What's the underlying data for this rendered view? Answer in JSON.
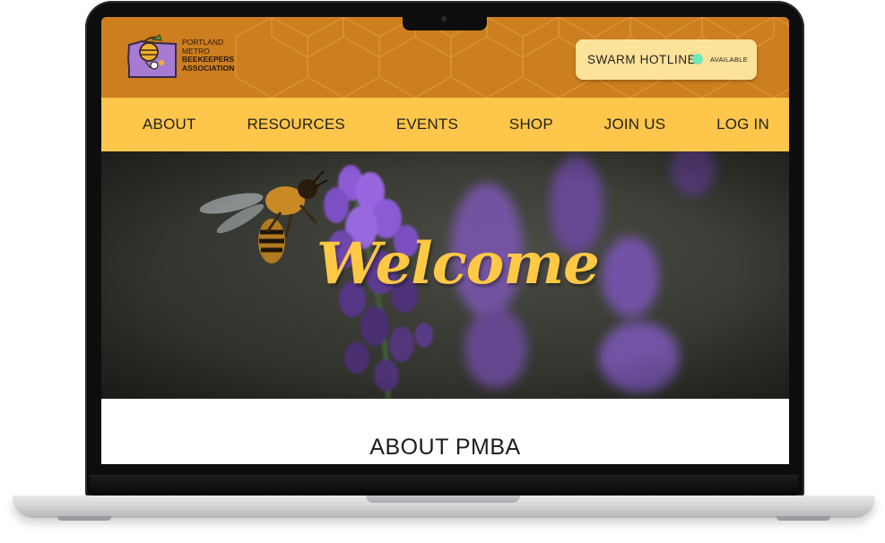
{
  "header": {
    "logo": {
      "line1": "PORTLAND",
      "line2": "METRO",
      "line3": "BEEKEEPERS",
      "line4": "ASSOCIATION"
    },
    "hotline": {
      "label": "SWARM HOTLINE",
      "status": "AVAILABLE",
      "status_color": "#71e8b9"
    }
  },
  "nav": {
    "items": [
      {
        "label": "ABOUT"
      },
      {
        "label": "RESOURCES"
      },
      {
        "label": "EVENTS"
      },
      {
        "label": "SHOP"
      },
      {
        "label": "JOIN US"
      },
      {
        "label": "LOG IN"
      }
    ]
  },
  "hero": {
    "heading": "Welcome"
  },
  "about": {
    "title": "ABOUT PMBA"
  },
  "colors": {
    "header_bg": "#cd7e1f",
    "nav_bg": "#fec64a",
    "accent_yellow": "#ffc845",
    "lavender": "#8a5cc9"
  }
}
